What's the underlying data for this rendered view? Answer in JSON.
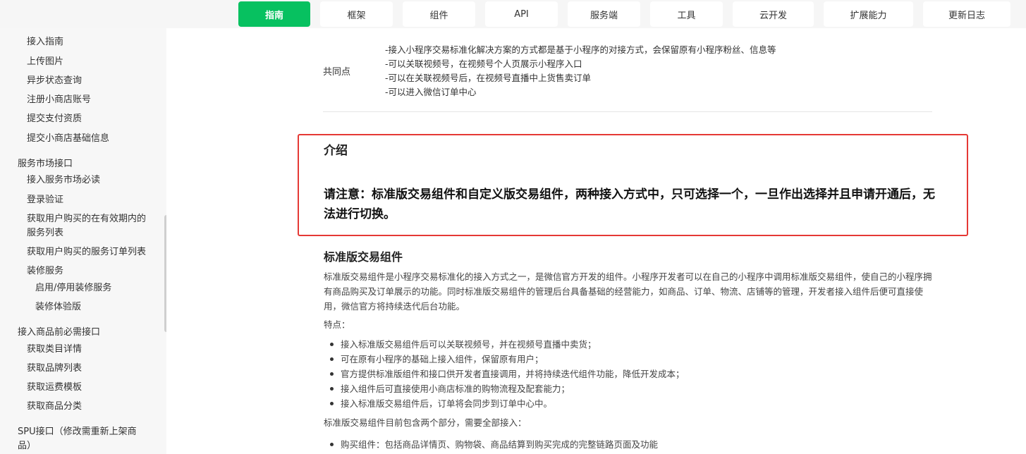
{
  "nav": {
    "tabs": [
      {
        "label": "指南",
        "active": true
      },
      {
        "label": "框架"
      },
      {
        "label": "组件"
      },
      {
        "label": "API"
      },
      {
        "label": "服务端"
      },
      {
        "label": "工具"
      },
      {
        "label": "云开发"
      },
      {
        "label": "扩展能力"
      },
      {
        "label": "更新日志"
      }
    ]
  },
  "sidebar": {
    "items": [
      "接入指南",
      "上传图片",
      "异步状态查询",
      "注册小商店账号",
      "提交支付资质",
      "提交小商店基础信息",
      "服务市场接口",
      "接入服务市场必读",
      "登录验证",
      "获取用户购买的在有效期内的",
      "服务列表",
      "获取用户购买的服务订单列表",
      "装修服务",
      "启用/停用装修服务",
      "装修体验版",
      "接入商品前必需接口",
      "获取类目详情",
      "获取品牌列表",
      "获取运费模板",
      "获取商品分类",
      "SPU接口（修改需重新上架商",
      "品）"
    ]
  },
  "content": {
    "common_label": "共同点",
    "common_points": [
      "-接入小程序交易标准化解决方案的方式都是基于小程序的对接方式，会保留原有小程序粉丝、信息等",
      "-可以关联视频号，在视频号个人页展示小程序入口",
      "-可以在关联视频号后，在视频号直播中上货售卖订单",
      "-可以进入微信订单中心"
    ],
    "intro_title": "介绍",
    "notice": "请注意：标准版交易组件和自定义版交易组件，两种接入方式中，只可选择一个，一旦作出选择并且申请开通后，无法进行切换。",
    "section_title": "标准版交易组件",
    "paragraph": "标准版交易组件是小程序交易标准化的接入方式之一，是微信官方开发的组件。小程序开发者可以在自己的小程序中调用标准版交易组件，使自己的小程序拥有商品购买及订单展示的功能。同时标准版交易组件的管理后台具备基础的经营能力，如商品、订单、物流、店铺等的管理，开发者接入组件后便可直接使用，微信官方将持续迭代后台功能。",
    "features_label": "特点：",
    "features": [
      "接入标准版交易组件后可以关联视频号，并在视频号直播中卖货；",
      "可在原有小程序的基础上接入组件，保留原有用户；",
      "官方提供标准版组件和接口供开发者直接调用，并将持续迭代组件功能，降低开发成本；",
      "接入组件后可直接使用小商店标准的购物流程及配套能力；",
      "接入标准版交易组件后，订单将会同步到订单中心中。"
    ],
    "parts_label": "标准版交易组件目前包含两个部分，需要全部接入：",
    "parts": [
      "购买组件：包括商品详情页、购物袋、商品结算到购买完成的完整链路页面及功能"
    ]
  },
  "colors": {
    "accent": "#07c160",
    "highlight_border": "#e53935"
  }
}
